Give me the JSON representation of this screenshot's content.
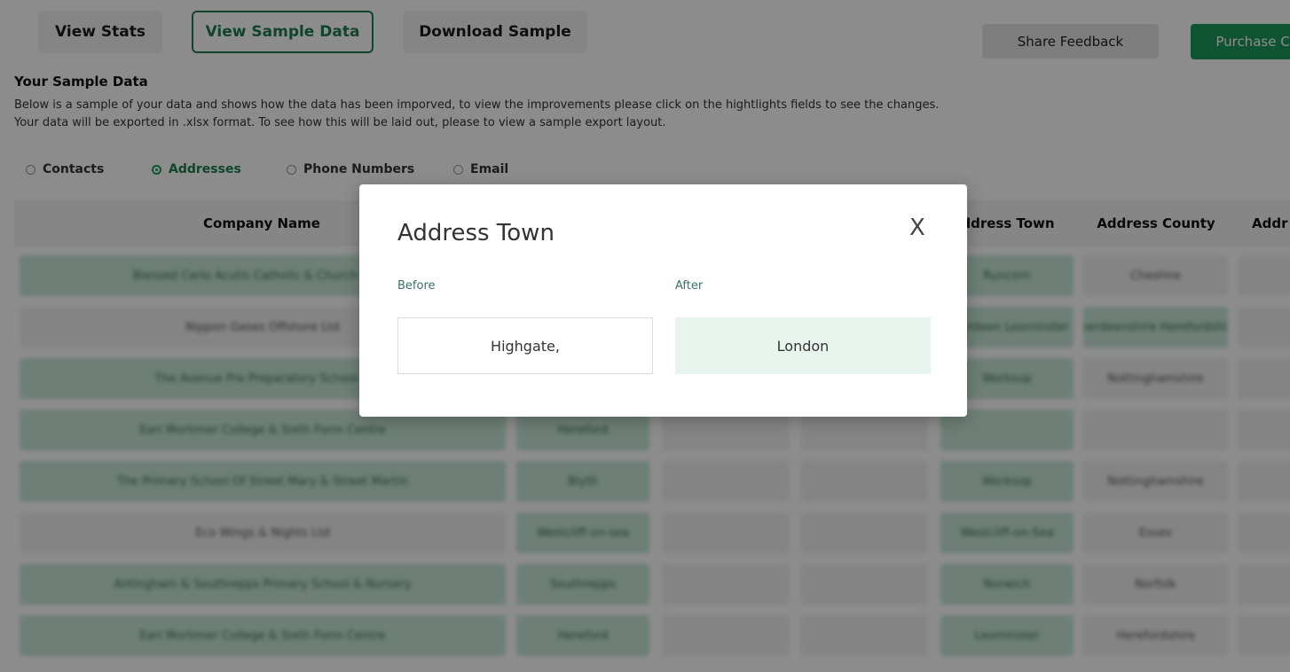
{
  "tabs": {
    "view_stats": "View Stats",
    "view_sample_data": "View Sample Data",
    "download_sample": "Download Sample"
  },
  "header_buttons": {
    "share_feedback": "Share Feedback",
    "purchase": "Purchase C"
  },
  "section": {
    "title": "Your Sample Data",
    "line1": "Below is a sample of your data and shows how the data has been imporved, to view the improvements please click on the hightlights fields to see the changes.",
    "line2": "Your data will be exported in .xlsx format. To see how this will be laid out, please to view a sample export layout."
  },
  "radios": [
    {
      "label": "Contacts",
      "checked": false
    },
    {
      "label": "Addresses",
      "checked": true
    },
    {
      "label": "Phone Numbers",
      "checked": false
    },
    {
      "label": "Email",
      "checked": false
    }
  ],
  "table": {
    "headers": [
      "Company Name",
      "ddress Town",
      "Address County",
      "Addr"
    ],
    "rows": [
      [
        "Blessed Carlo Acutis Catholic & Church Of En",
        "",
        "",
        "",
        "Runcorn",
        "Cheshire"
      ],
      [
        "Nippon Gases Offshore Ltd",
        "",
        "",
        "",
        "Aberdeen Leominster",
        "Aberdeenshire Herefordshire"
      ],
      [
        "The Avenue Pre Preparatory School &",
        "",
        "",
        "",
        "Worksop",
        "Nottinghamshire"
      ],
      [
        "Earl Mortimer College & Sixth Form Centre",
        "Hereford",
        "",
        "",
        "",
        ""
      ],
      [
        "The Primary School Of Street Mary & Street Martin",
        "Blyth",
        "",
        "",
        "Worksop",
        "Nottinghamshire"
      ],
      [
        "Eco Wings & Nights Ltd",
        "Westcliff-on-sea",
        "",
        "",
        "Westcliff-on-Sea",
        "Essex"
      ],
      [
        "Antingham & Southrepps Primary School & Nursery",
        "Southrepps",
        "",
        "",
        "Norwich",
        "Norfolk"
      ],
      [
        "Earl Mortimer College & Sixth Form Centre",
        "Hereford",
        "",
        "",
        "Leominster",
        "Herefordshire"
      ]
    ]
  },
  "modal": {
    "title": "Address Town",
    "close": "X",
    "before_label": "Before",
    "after_label": "After",
    "before_value": "Highgate,",
    "after_value": "London"
  }
}
